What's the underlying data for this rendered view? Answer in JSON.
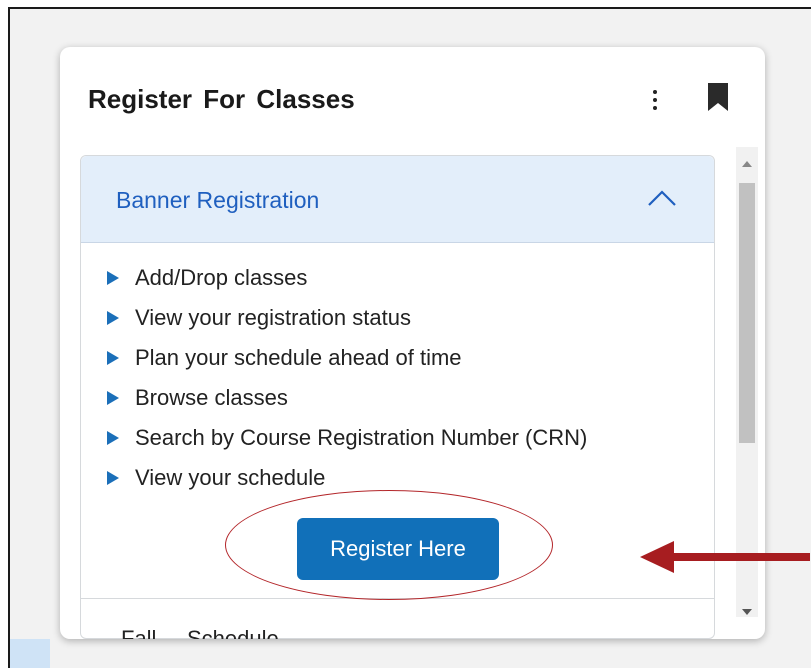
{
  "card": {
    "title": "Register For Classes",
    "menu_icon": "kebab-icon",
    "bookmark_icon": "bookmark-icon"
  },
  "accordion": {
    "header_label": "Banner Registration",
    "expanded": true,
    "chevron_icon": "chevron-up-icon",
    "items": [
      "Add/Drop classes",
      "View your registration status",
      "Plan your schedule ahead of time",
      "Browse classes",
      "Search by Course Registration Number (CRN)",
      "View your schedule"
    ],
    "button_label": "Register Here",
    "next_section_label": "Fall ... Schedule"
  },
  "colors": {
    "accent": "#1170b9",
    "header_bg": "#e3eefa",
    "header_text": "#1f5fbf",
    "annotation": "#b3262a"
  }
}
